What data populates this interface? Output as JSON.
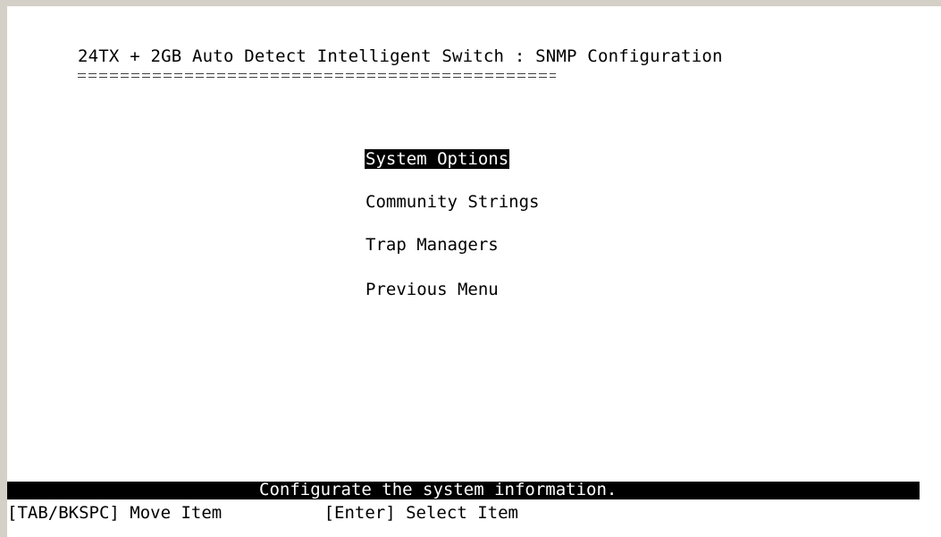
{
  "screen": {
    "title": "24TX + 2GB Auto Detect Intelligent Switch : SNMP Configuration"
  },
  "menu": {
    "items": [
      {
        "label": "System Options",
        "selected": true
      },
      {
        "label": "Community Strings",
        "selected": false
      },
      {
        "label": "Trap Managers",
        "selected": false
      },
      {
        "label": "Previous Menu",
        "selected": false
      }
    ]
  },
  "status": {
    "message": "Configurate the system information."
  },
  "help": {
    "text": "[TAB/BKSPC] Move Item          [Enter] Select Item"
  },
  "colors": {
    "background": "#ffffff",
    "foreground": "#000000",
    "highlight_bg": "#000000",
    "highlight_fg": "#ffffff",
    "frame": "#d4d0c8"
  }
}
